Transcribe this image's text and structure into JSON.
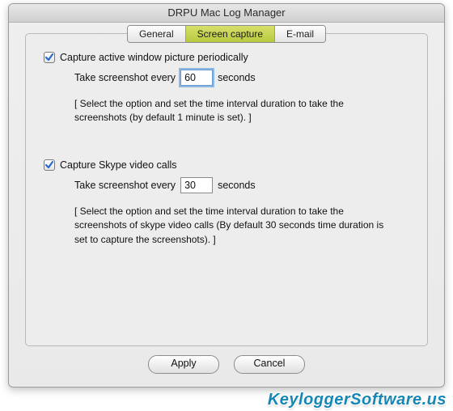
{
  "window": {
    "title": "DRPU Mac Log Manager"
  },
  "tabs": {
    "general": "General",
    "screen_capture": "Screen capture",
    "email": "E-mail"
  },
  "section1": {
    "checkbox_label": "Capture active window picture periodically",
    "checked": true,
    "take_prefix": "Take screenshot every",
    "interval_value": "60",
    "take_suffix": "seconds",
    "description": "[ Select the option and set the time interval duration to take the screenshots (by default 1 minute is set). ]"
  },
  "section2": {
    "checkbox_label": "Capture Skype video calls",
    "checked": true,
    "take_prefix": "Take screenshot every",
    "interval_value": "30",
    "take_suffix": "seconds",
    "description": "[ Select the option and set the time interval duration to take the screenshots of skype video calls (By default 30 seconds time duration is set to capture the screenshots). ]"
  },
  "buttons": {
    "apply": "Apply",
    "cancel": "Cancel"
  },
  "watermark": "KeyloggerSoftware.us"
}
